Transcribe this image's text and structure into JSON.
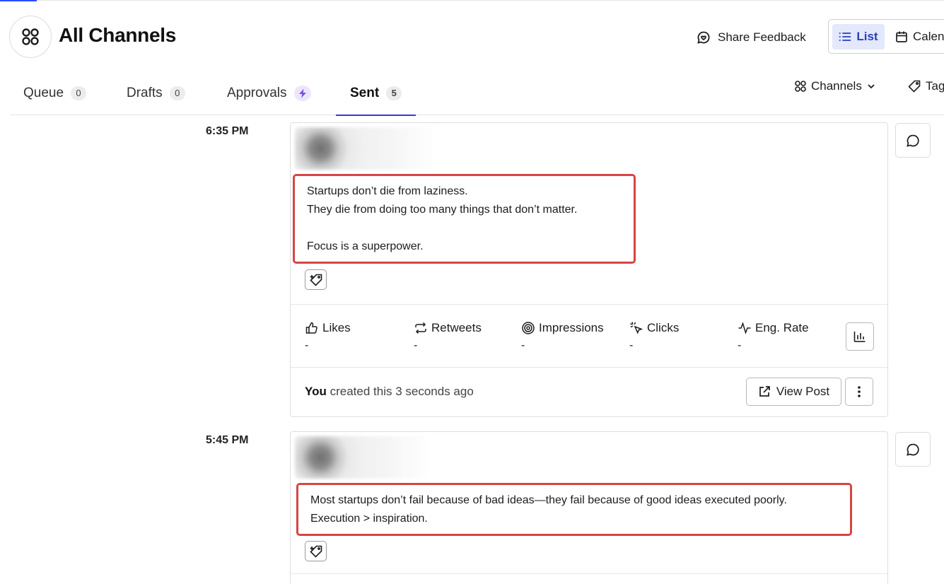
{
  "header": {
    "title": "All Channels",
    "share_feedback": "Share Feedback",
    "view_list": "List",
    "view_calendar": "Calen"
  },
  "tabs": [
    {
      "label": "Queue",
      "count": "0"
    },
    {
      "label": "Drafts",
      "count": "0"
    },
    {
      "label": "Approvals",
      "icon": "bolt-icon"
    },
    {
      "label": "Sent",
      "count": "5",
      "active": true
    }
  ],
  "filters": {
    "channels": "Channels",
    "tags": "Tag"
  },
  "posts": [
    {
      "time": "6:35 PM",
      "lines": [
        "Startups don’t die from laziness.",
        "They die from doing too many things that don’t matter.",
        "",
        "Focus is a superpower."
      ],
      "metrics": [
        {
          "label": "Likes",
          "value": "-"
        },
        {
          "label": "Retweets",
          "value": "-"
        },
        {
          "label": "Impressions",
          "value": "-"
        },
        {
          "label": "Clicks",
          "value": "-"
        },
        {
          "label": "Eng. Rate",
          "value": "-"
        }
      ],
      "created_by": "You",
      "created_text": "created this 3 seconds ago",
      "view_post": "View Post"
    },
    {
      "time": "5:45 PM",
      "lines": [
        "Most startups don’t fail because of bad ideas—they fail because of good ideas executed poorly.",
        "Execution > inspiration."
      ]
    }
  ],
  "colors": {
    "accent": "#2c3fd6",
    "highlight_box": "#d64545",
    "list_toggle_bg": "#e3e8fb"
  }
}
